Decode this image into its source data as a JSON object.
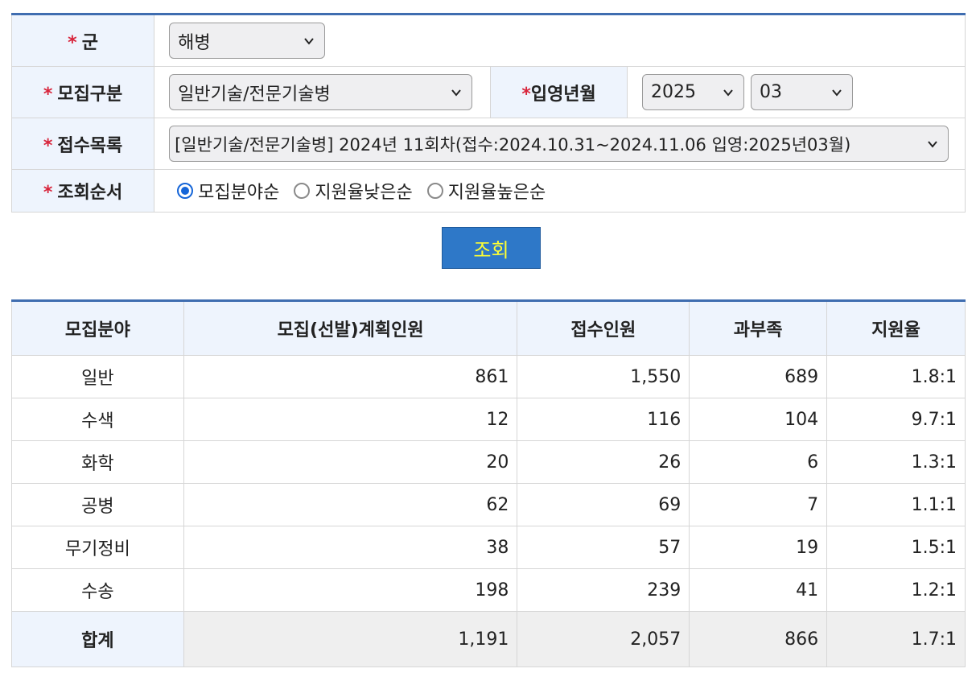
{
  "form": {
    "req_mark": "*",
    "branch_label": "군",
    "branch_value": "해병",
    "type_label": "모집구분",
    "type_value": "일반기술/전문기술병",
    "enlist_label": "입영년월",
    "year_value": "2025",
    "month_value": "03",
    "list_label": "접수목록",
    "list_value": "[일반기술/전문기술병] 2024년 11회차(접수:2024.10.31~2024.11.06 입영:2025년03월)",
    "order_label": "조회순서",
    "order_options": [
      "모집분야순",
      "지원율낮은순",
      "지원율높은순"
    ],
    "order_selected": 0
  },
  "search_button": "조회",
  "table": {
    "headers": [
      "모집분야",
      "모집(선발)계획인원",
      "접수인원",
      "과부족",
      "지원율"
    ],
    "rows": [
      [
        "일반",
        "861",
        "1,550",
        "689",
        "1.8:1"
      ],
      [
        "수색",
        "12",
        "116",
        "104",
        "9.7:1"
      ],
      [
        "화학",
        "20",
        "26",
        "6",
        "1.3:1"
      ],
      [
        "공병",
        "62",
        "69",
        "7",
        "1.1:1"
      ],
      [
        "무기정비",
        "38",
        "57",
        "19",
        "1.5:1"
      ],
      [
        "수송",
        "198",
        "239",
        "41",
        "1.2:1"
      ]
    ],
    "total": [
      "합계",
      "1,191",
      "2,057",
      "866",
      "1.7:1"
    ]
  }
}
